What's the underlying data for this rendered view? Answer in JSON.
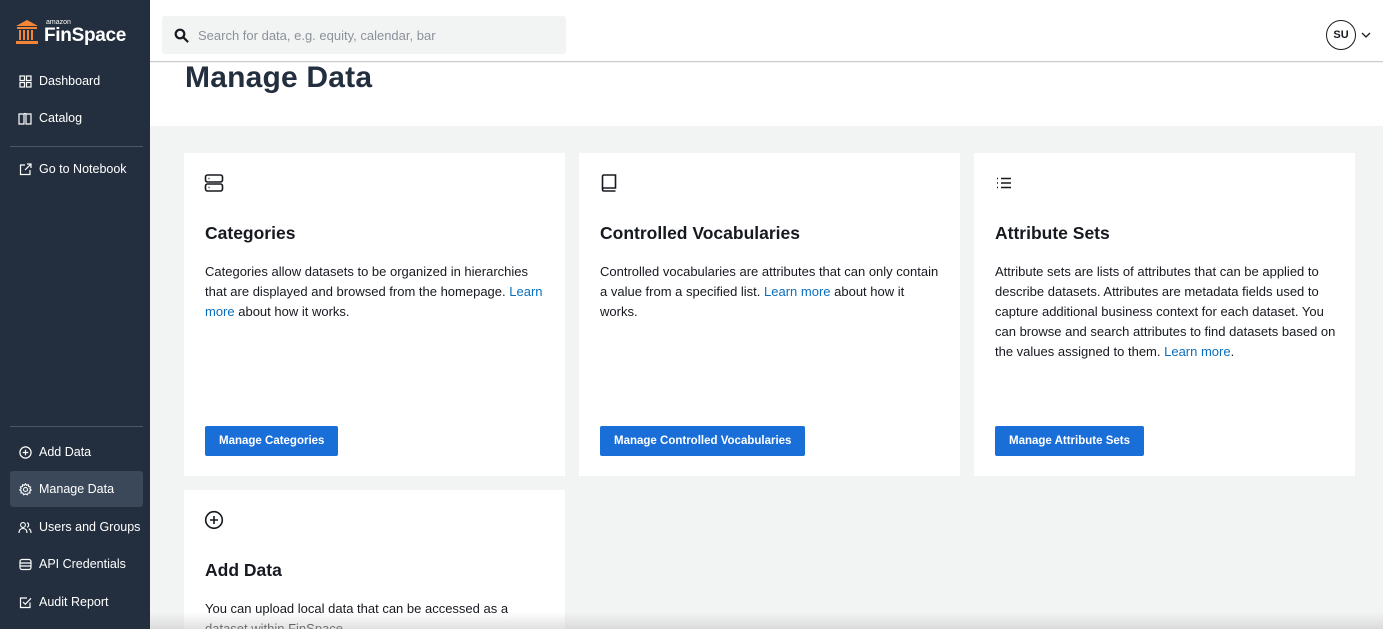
{
  "brand": {
    "small": "amazon",
    "name": "FinSpace"
  },
  "search": {
    "placeholder": "Search for data, e.g. equity, calendar, bar"
  },
  "user": {
    "initials": "SU"
  },
  "sidebar": {
    "top": [
      {
        "label": "Dashboard"
      },
      {
        "label": "Catalog"
      },
      {
        "label": "Go to Notebook"
      }
    ],
    "bottom": [
      {
        "label": "Add Data"
      },
      {
        "label": "Manage Data"
      },
      {
        "label": "Users and Groups"
      },
      {
        "label": "API Credentials"
      },
      {
        "label": "Audit Report"
      }
    ]
  },
  "page": {
    "title": "Manage Data"
  },
  "cards": [
    {
      "title": "Categories",
      "desc_before": "Categories allow datasets to be organized in hierarchies that are displayed and browsed from the homepage. ",
      "link": "Learn more",
      "desc_after": " about how it works.",
      "button": "Manage Categories"
    },
    {
      "title": "Controlled Vocabularies",
      "desc_before": "Controlled vocabularies are attributes that can only contain a value from a specified list. ",
      "link": "Learn more",
      "desc_after": " about how it works.",
      "button": "Manage Controlled Vocabularies"
    },
    {
      "title": "Attribute Sets",
      "desc_before": "Attribute sets are lists of attributes that can be applied to describe datasets. Attributes are metadata fields used to capture additional business context for each dataset. You can browse and search attributes to find datasets based on the values assigned to them. ",
      "link": "Learn more",
      "desc_after": ".",
      "button": "Manage Attribute Sets"
    },
    {
      "title": "Add Data",
      "desc_before": "You can upload local data that can be accessed as a dataset within FinSpace."
    }
  ]
}
